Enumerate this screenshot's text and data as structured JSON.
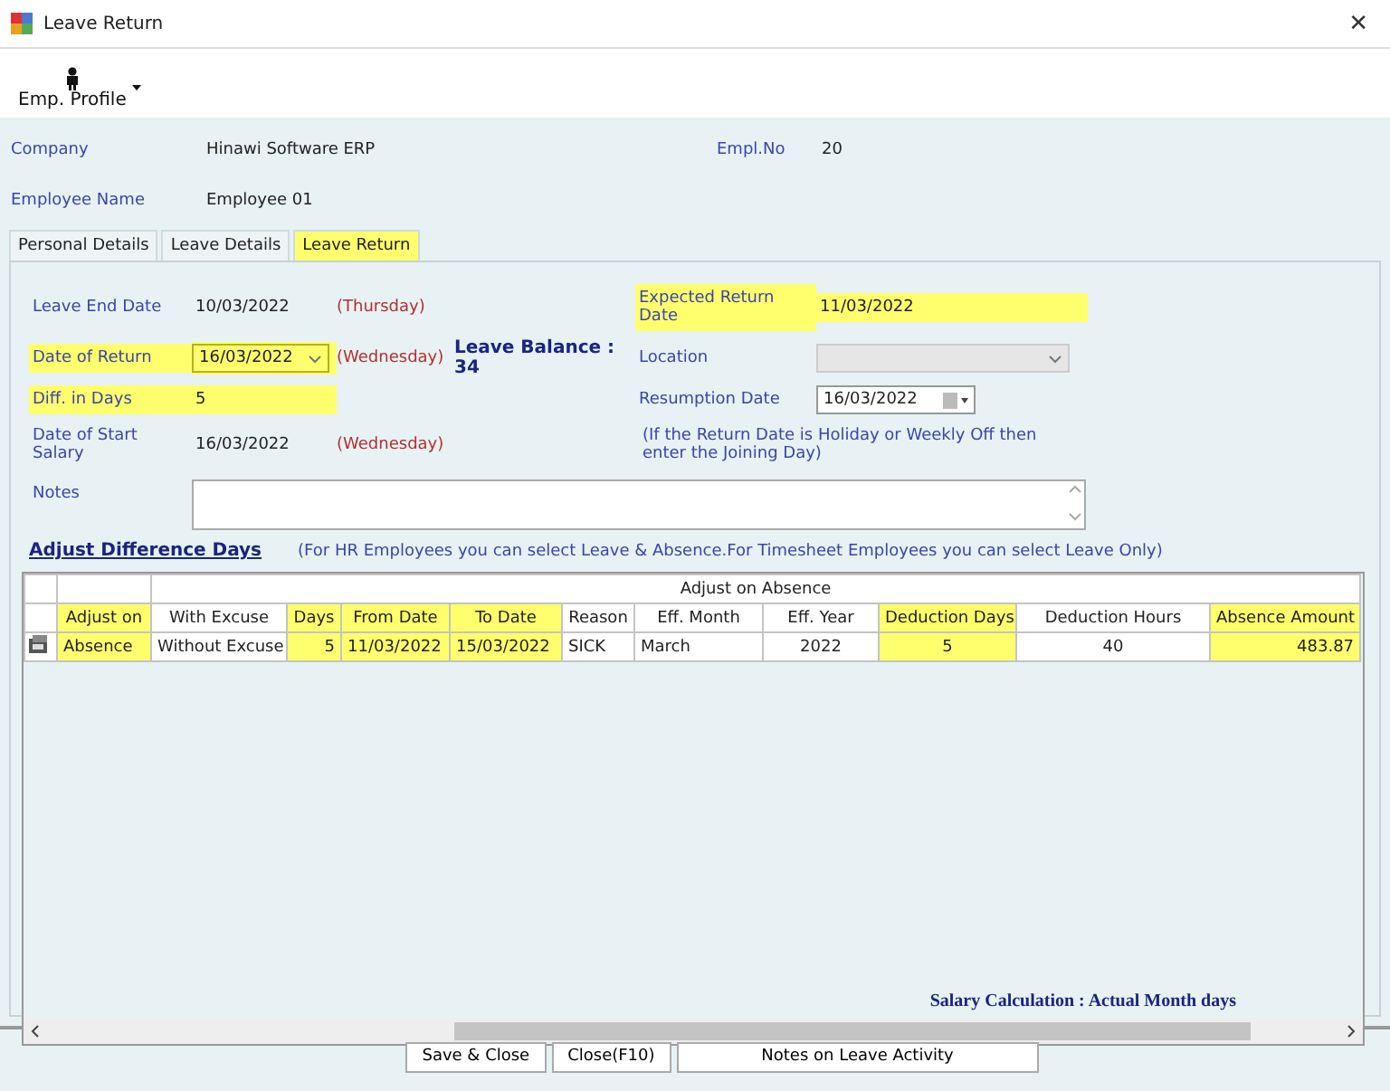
{
  "window": {
    "title": "Leave Return",
    "close": "✕"
  },
  "toolbar": {
    "items": [
      {
        "label": "Emp. Profile"
      }
    ]
  },
  "header": {
    "fields": [
      {
        "label": "Company",
        "value": "Hinawi Software ERP"
      },
      {
        "label": "Empl.No",
        "value": "20"
      },
      {
        "label": "Employee Name",
        "value": "Employee 01"
      }
    ]
  },
  "tabs": [
    {
      "label": "Personal Details",
      "selected": false
    },
    {
      "label": "Leave Details",
      "selected": false
    },
    {
      "label": "Leave Return",
      "selected": true
    }
  ],
  "form": {
    "leave_end_date": {
      "label": "Leave End Date",
      "value": "10/03/2022",
      "day": "(Thursday)",
      "highlighted": false
    },
    "expected_return_date": {
      "label": "Expected Return Date",
      "value": "11/03/2022",
      "highlighted": true
    },
    "date_of_return": {
      "label": "Date of Return",
      "value": "16/03/2022",
      "day": "(Wednesday)",
      "highlighted": true
    },
    "leave_balance": "Leave Balance : 34",
    "location": {
      "label": "Location",
      "disabled": true
    },
    "diff_in_days": {
      "label": "Diff. in Days",
      "value": "5",
      "highlighted": true
    },
    "resumption_date": {
      "label": "Resumption Date",
      "value": "16/03/2022"
    },
    "resumption_note": "(If the Return Date is Holiday or Weekly Off then enter the Joining Day)",
    "start_salary": {
      "label": "Date of Start Salary",
      "value": "16/03/2022",
      "day": "(Wednesday)",
      "highlighted": false
    },
    "notes": {
      "label": "Notes"
    }
  },
  "adjust": {
    "link": "Adjust Difference Days",
    "note": "(For HR Employees you can select Leave & Absence.For Timesheet Employees you can select Leave Only)"
  },
  "table": {
    "group_header": "Adjust on Absence",
    "columns": [
      {
        "label": "Adjust on",
        "highlighted": true
      },
      {
        "label": "With Excuse",
        "highlighted": false
      },
      {
        "label": "Days",
        "highlighted": true
      },
      {
        "label": "From Date",
        "highlighted": true
      },
      {
        "label": "To Date",
        "highlighted": true
      },
      {
        "label": "Reason",
        "highlighted": false
      },
      {
        "label": "Eff. Month",
        "highlighted": false
      },
      {
        "label": "Eff. Year",
        "highlighted": false
      },
      {
        "label": "Deduction Days",
        "highlighted": true
      },
      {
        "label": "Deduction Hours",
        "highlighted": false
      },
      {
        "label": "Absence Amount",
        "highlighted": true
      }
    ],
    "rows": [
      {
        "cells": [
          "Absence",
          "Without Excuse",
          "5",
          "11/03/2022",
          "15/03/2022",
          "SICK",
          "March",
          "2022",
          "5",
          "40",
          "483.87"
        ]
      }
    ],
    "footer": "Salary Calculation : Actual Month days"
  },
  "buttons": [
    "Save & Close",
    "Close(F10)",
    "Notes on Leave Activity"
  ]
}
